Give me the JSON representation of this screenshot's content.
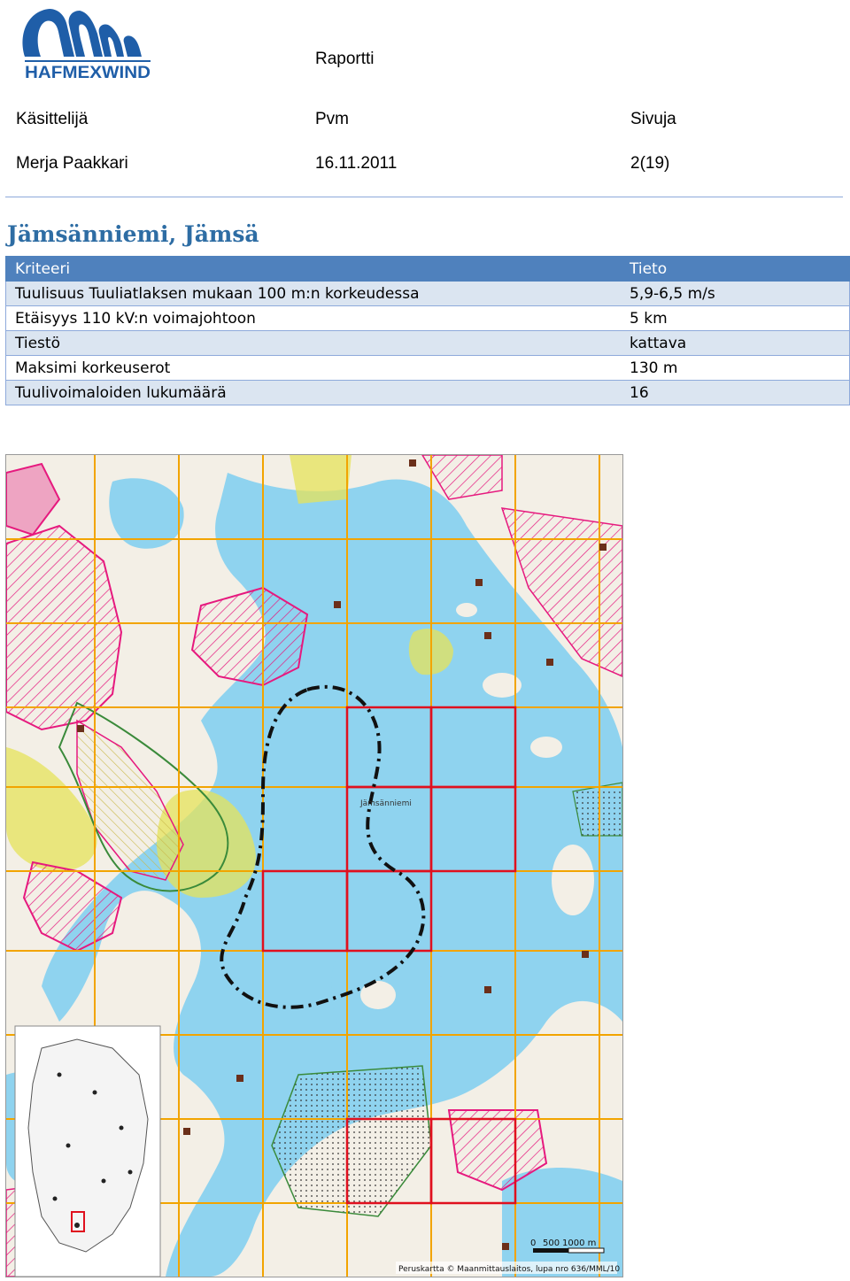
{
  "header": {
    "logo_text": "HAFMEXWIND",
    "report_label": "Raportti",
    "handler_label": "Käsittelijä",
    "handler_value": "Merja Paakkari",
    "date_label": "Pvm",
    "date_value": "16.11.2011",
    "pages_label": "Sivuja",
    "pages_value": "2(19)"
  },
  "title": "Jämsänniemi, Jämsä",
  "table": {
    "headers": [
      "Kriteeri",
      "Tieto"
    ],
    "rows": [
      [
        "Tuulisuus Tuuliatlaksen mukaan 100 m:n korkeudessa",
        "5,9-6,5 m/s"
      ],
      [
        "Etäisyys 110 kV:n voimajohtoon",
        "5 km"
      ],
      [
        "Tiestö",
        "kattava"
      ],
      [
        "Maksimi korkeuserot",
        "130 m"
      ],
      [
        "Tuulivoimaloiden lukumäärä",
        "16"
      ]
    ]
  },
  "map": {
    "place_label": "Jämsänniemi",
    "scale_start": "0",
    "scale_mid": "500",
    "scale_end": "1000 m",
    "credit": "Peruskartta © Maanmittauslaitos, lupa nro 636/MML/10"
  },
  "colors": {
    "title": "#2e6da4",
    "table_header": "#4f81bd",
    "table_alt_row": "#dbe5f1",
    "water": "#8fd3ef",
    "land": "#f3efe6",
    "zoning_pink": "#e6197e",
    "field_yellow": "#e6e35a",
    "grid_orange": "#f2a400",
    "grid_red": "#e0101e"
  }
}
